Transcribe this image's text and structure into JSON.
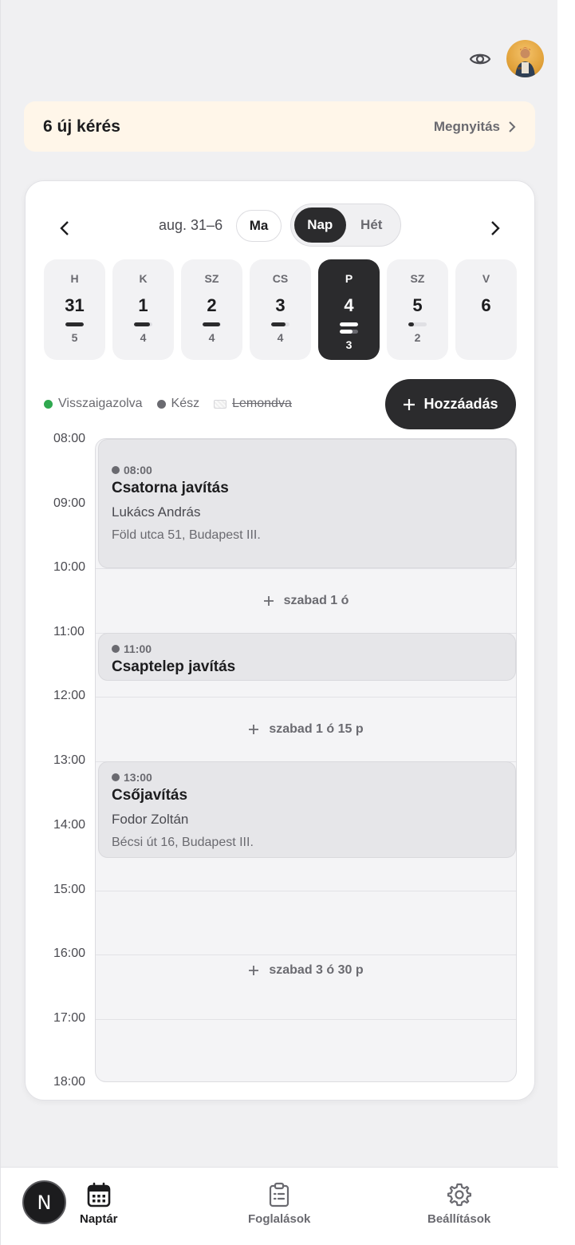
{
  "header": {
    "eye_icon": "eye-icon",
    "avatar_icon": "avatar"
  },
  "banner": {
    "title": "6 új kérés",
    "link_label": "Megnyitás"
  },
  "calendar": {
    "range_label": "aug. 31–6",
    "today_label": "Ma",
    "view_modes": {
      "day": "Nap",
      "week": "Hét",
      "selected": "Nap"
    },
    "days": [
      {
        "letter": "H",
        "num": "31",
        "count": "5",
        "bars": [
          1.0
        ],
        "active": false
      },
      {
        "letter": "K",
        "num": "1",
        "count": "4",
        "bars": [
          0.85
        ],
        "active": false
      },
      {
        "letter": "SZ",
        "num": "2",
        "count": "4",
        "bars": [
          0.95
        ],
        "active": false
      },
      {
        "letter": "CS",
        "num": "3",
        "count": "4",
        "bars": [
          0.8
        ],
        "active": false
      },
      {
        "letter": "P",
        "num": "4",
        "count": "3",
        "bars": [
          1.0,
          0.7
        ],
        "active": true
      },
      {
        "letter": "SZ",
        "num": "5",
        "count": "2",
        "bars": [
          0.3
        ],
        "active": false
      },
      {
        "letter": "V",
        "num": "6",
        "count": "",
        "bars": [],
        "active": false
      }
    ],
    "legend": {
      "confirmed": "Visszaigazolva",
      "done": "Kész",
      "cancelled": "Lemondva",
      "confirmed_color": "#2fa84f",
      "done_color": "#6a6a70"
    },
    "add_button": "Hozzáadás",
    "hours": [
      "08:00",
      "09:00",
      "10:00",
      "11:00",
      "12:00",
      "13:00",
      "14:00",
      "15:00",
      "16:00",
      "17:00",
      "18:00"
    ],
    "events": [
      {
        "time": "08:00",
        "title": "Csatorna javítás",
        "client": "Lukács András",
        "address": "Föld utca 51, Budapest III."
      },
      {
        "time": "11:00",
        "title": "Csaptelep javítás"
      },
      {
        "time": "13:00",
        "title": "Csőjavítás",
        "client": "Fodor Zoltán",
        "address": "Bécsi út 16, Budapest III."
      }
    ],
    "free_slots": [
      "szabad 1 ó",
      "szabad 1 ó 15 p",
      "szabad 3 ó 30 p"
    ]
  },
  "bottom_nav": {
    "brand_letter": "N",
    "items": [
      {
        "label": "Naptár",
        "icon": "calendar-icon",
        "active": true
      },
      {
        "label": "Foglalások",
        "icon": "clipboard-icon",
        "active": false
      },
      {
        "label": "Beállítások",
        "icon": "gear-icon",
        "active": false
      }
    ]
  }
}
